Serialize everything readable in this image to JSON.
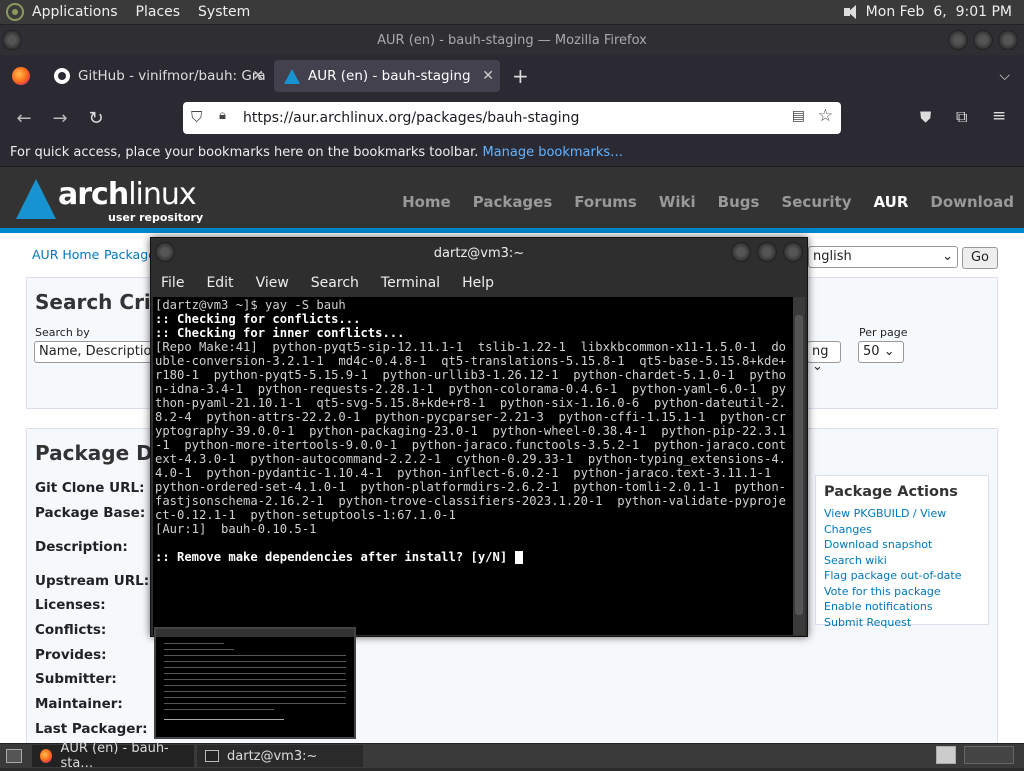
{
  "top_panel": {
    "menus": [
      "Applications",
      "Places",
      "System"
    ],
    "clock": "Mon Feb  6,  9:01 PM"
  },
  "browser": {
    "window_title": "AUR (en) - bauh-staging — Mozilla Firefox",
    "tabs": [
      {
        "label": "GitHub - vinifmor/bauh: Gra",
        "active": false
      },
      {
        "label": "AUR (en) - bauh-staging",
        "active": true
      }
    ],
    "new_tab": "+",
    "url": "https://aur.archlinux.org/packages/bauh-staging",
    "bookmarks_bar": {
      "text": "For quick access, place your bookmarks here on the bookmarks toolbar.",
      "link": "Manage bookmarks…"
    }
  },
  "page": {
    "logo_main": "arch",
    "logo_main2": "linux",
    "logo_sub": "user repository",
    "nav": [
      "Home",
      "Packages",
      "Forums",
      "Wiki",
      "Bugs",
      "Security",
      "AUR",
      "Download"
    ],
    "breadcrumb": [
      "AUR Home",
      "Package"
    ],
    "language_select": "nglish",
    "go_button": "Go",
    "search": {
      "title": "Search Crite",
      "search_by_label": "Search by",
      "search_by_value": "Name, Description",
      "sort_value": "ng",
      "per_page_label": "Per page",
      "per_page_value": "50"
    },
    "details": {
      "title": "Package Det",
      "labels": [
        "Git Clone URL:",
        "Package Base:",
        "Description:",
        "Upstream URL:",
        "Licenses:",
        "Conflicts:",
        "Provides:",
        "Submitter:",
        "Maintainer:",
        "Last Packager:"
      ]
    },
    "actions": {
      "title": "Package Actions",
      "links": [
        "View PKGBUILD / View Changes",
        "Download snapshot",
        "Search wiki",
        "Flag package out-of-date",
        "Vote for this package",
        "Enable notifications",
        "Submit Request"
      ]
    }
  },
  "terminal": {
    "title": "dartz@vm3:~",
    "menu": [
      "File",
      "Edit",
      "View",
      "Search",
      "Terminal",
      "Help"
    ],
    "lines": [
      {
        "t": "[dartz@vm3 ~]$ yay -S bauh",
        "b": false
      },
      {
        "t": ":: Checking for conflicts...",
        "b": true
      },
      {
        "t": ":: Checking for inner conflicts...",
        "b": true
      },
      {
        "t": "[Repo Make:41]  python-pyqt5-sip-12.11.1-1  tslib-1.22-1  libxkbcommon-x11-1.5.0-1  double-conversion-3.2.1-1  md4c-0.4.8-1  qt5-translations-5.15.8-1  qt5-base-5.15.8+kde+r180-1  python-pyqt5-5.15.9-1  python-urllib3-1.26.12-1  python-chardet-5.1.0-1  python-idna-3.4-1  python-requests-2.28.1-1  python-colorama-0.4.6-1  python-yaml-6.0-1  python-pyaml-21.10.1-1  qt5-svg-5.15.8+kde+r8-1  python-six-1.16.0-6  python-dateutil-2.8.2-4  python-attrs-22.2.0-1  python-pycparser-2.21-3  python-cffi-1.15.1-1  python-cryptography-39.0.0-1  python-packaging-23.0-1  python-wheel-0.38.4-1  python-pip-22.3.1-1  python-more-itertools-9.0.0-1  python-jaraco.functools-3.5.2-1  python-jaraco.context-4.3.0-1  python-autocommand-2.2.2-1  cython-0.29.33-1  python-typing_extensions-4.4.0-1  python-pydantic-1.10.4-1  python-inflect-6.0.2-1  python-jaraco.text-3.11.1-1  python-ordered-set-4.1.0-1  python-platformdirs-2.6.2-1  python-tomli-2.0.1-1  python-fastjsonschema-2.16.2-1  python-trove-classifiers-2023.1.20-1  python-validate-pyproject-0.12.1-1  python-setuptools-1:67.1.0-1",
        "b": false
      },
      {
        "t": "[Aur:1]  bauh-0.10.5-1",
        "b": false
      },
      {
        "t": "",
        "b": false
      },
      {
        "t": ":: Remove make dependencies after install? [y/N] ",
        "b": true
      }
    ]
  },
  "taskbar": {
    "tasks": [
      "AUR (en) - bauh-sta…",
      "dartz@vm3:~"
    ]
  }
}
